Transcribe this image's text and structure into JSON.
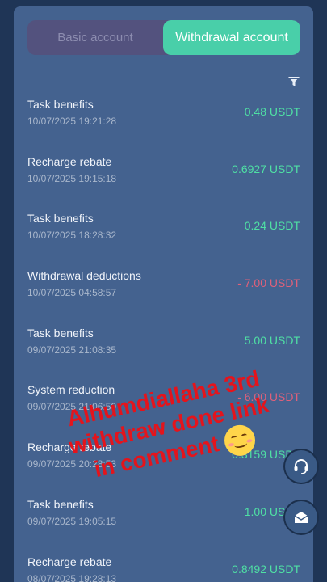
{
  "tabs": {
    "basic": "Basic account",
    "withdrawal": "Withdrawal account",
    "active": "withdrawal"
  },
  "icons": {
    "filter": "filter-icon",
    "support": "headset-icon",
    "mail": "mail-icon"
  },
  "records": [
    {
      "title": "Task benefits",
      "time": "10/07/2025 19:21:28",
      "amount": "0.48 USDT",
      "sign": "positive"
    },
    {
      "title": "Recharge rebate",
      "time": "10/07/2025 19:15:18",
      "amount": "0.6927 USDT",
      "sign": "positive"
    },
    {
      "title": "Task benefits",
      "time": "10/07/2025 18:28:32",
      "amount": "0.24 USDT",
      "sign": "positive"
    },
    {
      "title": "Withdrawal deductions",
      "time": "10/07/2025 04:58:57",
      "amount": "- 7.00 USDT",
      "sign": "negative"
    },
    {
      "title": "Task benefits",
      "time": "09/07/2025 21:08:35",
      "amount": "5.00 USDT",
      "sign": "positive"
    },
    {
      "title": "System reduction",
      "time": "09/07/2025 21:06:50",
      "amount": "- 6.00 USDT",
      "sign": "negative"
    },
    {
      "title": "Recharge rebate",
      "time": "09/07/2025 20:28:53",
      "amount": "0.3159 USDT",
      "sign": "positive"
    },
    {
      "title": "Task benefits",
      "time": "09/07/2025 19:05:15",
      "amount": "1.00 USDT",
      "sign": "positive"
    },
    {
      "title": "Recharge rebate",
      "time": "08/07/2025 19:28:13",
      "amount": "0.8492 USDT",
      "sign": "positive"
    }
  ],
  "overlay": {
    "text": "Alhumdiallaha 3rd\nwithdraw done link\nin comment",
    "emoji": "smiling-face-emoji"
  },
  "colors": {
    "positive": "#4fe0a4",
    "negative": "#e0607a",
    "accent": "#49cfa9"
  }
}
